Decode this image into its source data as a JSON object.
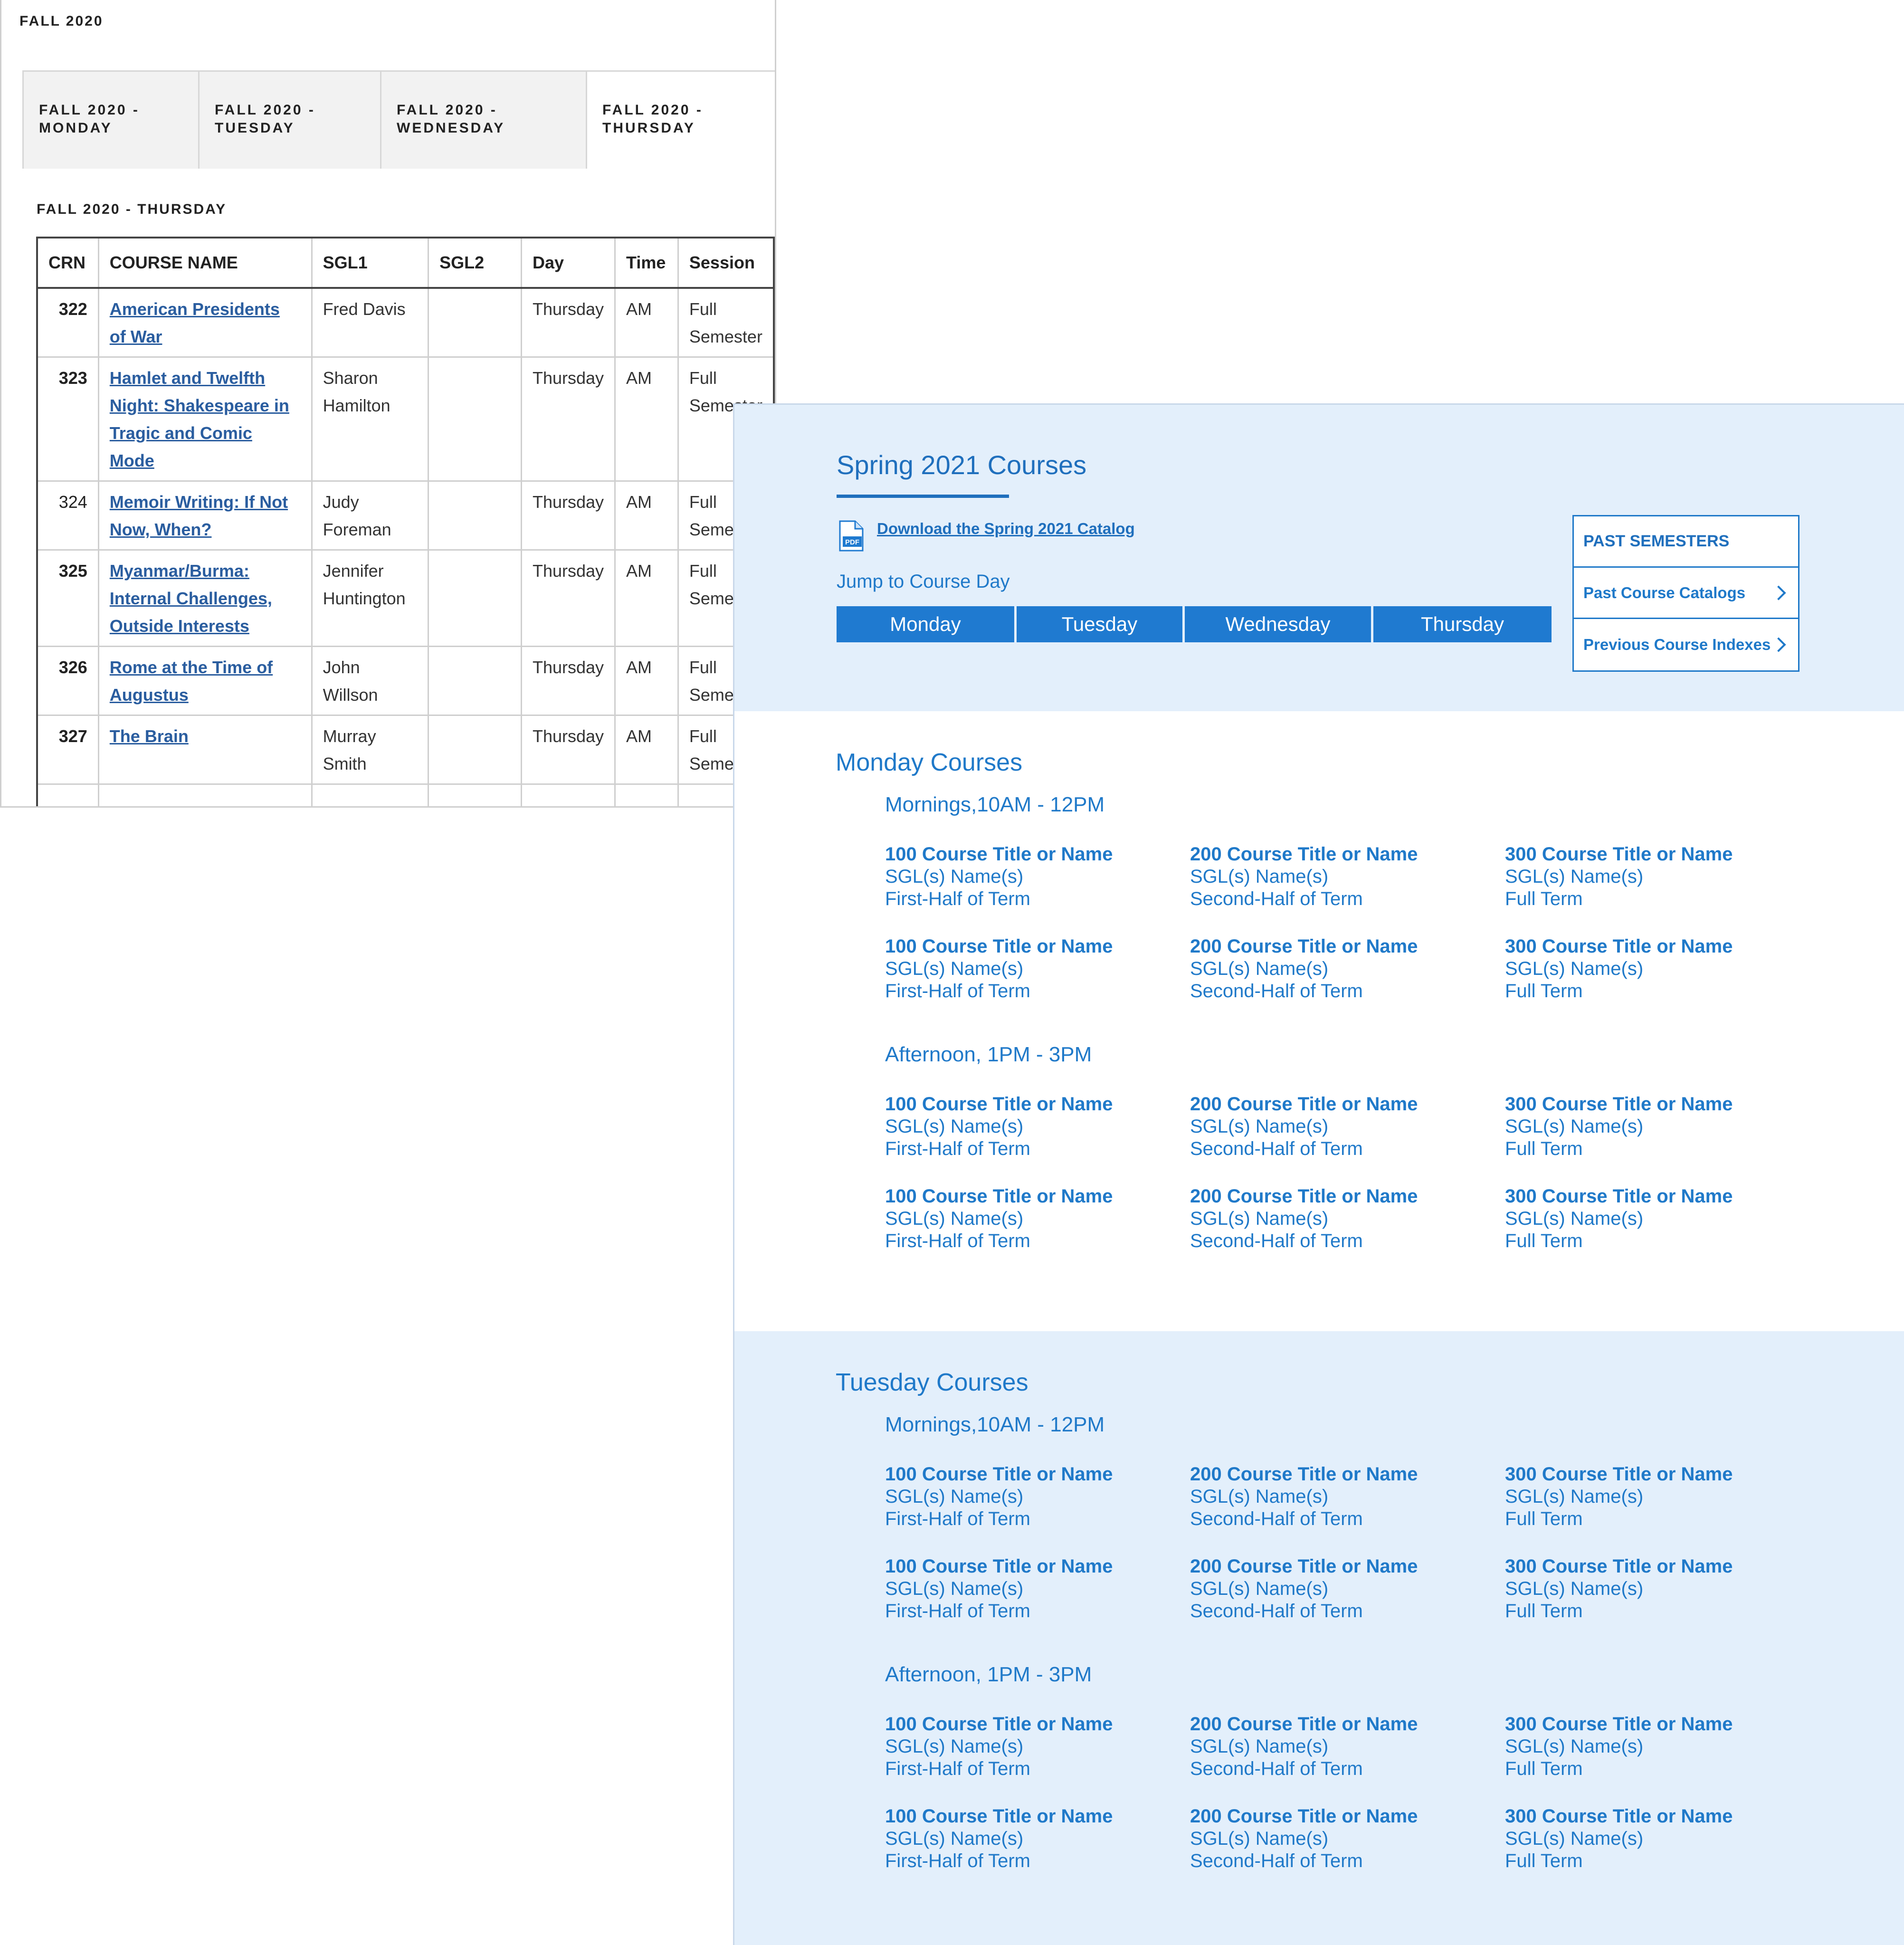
{
  "fall": {
    "title": "FALL 2020",
    "tabs": [
      "FALL 2020 -\nMONDAY",
      "FALL 2020 -\nTUESDAY",
      "FALL 2020 -\nWEDNESDAY",
      "FALL 2020 -\nTHURSDAY"
    ],
    "active_tab": 3,
    "section_title": "FALL 2020 - THURSDAY",
    "table": {
      "headers": [
        "CRN",
        "COURSE NAME",
        "SGL1",
        "SGL2",
        "Day",
        "Time",
        "Session"
      ],
      "rows": [
        {
          "crn": "322",
          "name": "American Presidents of War",
          "sgl1": "Fred Davis",
          "sgl2": "",
          "day": "Thursday",
          "time": "AM",
          "session": "Full Semester"
        },
        {
          "crn": "323",
          "name": "Hamlet and Twelfth Night: Shakespeare in Tragic and Comic Mode",
          "sgl1": "Sharon Hamilton",
          "sgl2": "",
          "day": "Thursday",
          "time": "AM",
          "session": "Full Semester"
        },
        {
          "crn": "324",
          "name": "Memoir Writing: If Not Now, When?",
          "sgl1": "Judy Foreman",
          "sgl2": "",
          "day": "Thursday",
          "time": "AM",
          "session": "Full Semester"
        },
        {
          "crn": "325",
          "name": "Myanmar/Burma: Internal Challenges, Outside Interests",
          "sgl1": "Jennifer Huntington",
          "sgl2": "",
          "day": "Thursday",
          "time": "AM",
          "session": "Full Semester"
        },
        {
          "crn": "326",
          "name": "Rome at the Time of Augustus",
          "sgl1": "John Willson",
          "sgl2": "",
          "day": "Thursday",
          "time": "AM",
          "session": "Full Semester"
        },
        {
          "crn": "327",
          "name": "The Brain",
          "sgl1": "Murray Smith",
          "sgl2": "",
          "day": "Thursday",
          "time": "AM",
          "session": "Full Semester"
        }
      ]
    }
  },
  "spring": {
    "title": "Spring 2021 Courses",
    "download_label": "Download the Spring 2021 Catalog",
    "pdf_icon_label": "PDF",
    "jump_label": "Jump to Course Day",
    "day_buttons": [
      "Monday",
      "Tuesday",
      "Wednesday",
      "Thursday"
    ],
    "past": {
      "header": "PAST SEMESTERS",
      "links": [
        "Past Course Catalogs",
        "Previous Course Indexes"
      ]
    },
    "days": [
      {
        "title": "Monday Courses",
        "periods": [
          {
            "title": "Mornings,10AM - 12PM",
            "rows": [
              [
                {
                  "title": "100 Course Title or Name",
                  "sgl": "SGL(s) Name(s)",
                  "term": "First-Half of Term"
                },
                {
                  "title": "200 Course Title or Name",
                  "sgl": "SGL(s) Name(s)",
                  "term": "Second-Half of Term"
                },
                {
                  "title": "300 Course Title or Name",
                  "sgl": "SGL(s) Name(s)",
                  "term": "Full Term"
                }
              ],
              [
                {
                  "title": "100 Course Title or Name",
                  "sgl": "SGL(s) Name(s)",
                  "term": "First-Half of Term"
                },
                {
                  "title": "200 Course Title or Name",
                  "sgl": "SGL(s) Name(s)",
                  "term": "Second-Half of Term"
                },
                {
                  "title": "300 Course Title or Name",
                  "sgl": "SGL(s) Name(s)",
                  "term": "Full Term"
                }
              ]
            ]
          },
          {
            "title": "Afternoon, 1PM - 3PM",
            "rows": [
              [
                {
                  "title": "100 Course Title or Name",
                  "sgl": "SGL(s) Name(s)",
                  "term": "First-Half of Term"
                },
                {
                  "title": "200 Course Title or Name",
                  "sgl": "SGL(s) Name(s)",
                  "term": "Second-Half of Term"
                },
                {
                  "title": "300 Course Title or Name",
                  "sgl": "SGL(s) Name(s)",
                  "term": "Full Term"
                }
              ],
              [
                {
                  "title": "100 Course Title or Name",
                  "sgl": "SGL(s) Name(s)",
                  "term": "First-Half of Term"
                },
                {
                  "title": "200 Course Title or Name",
                  "sgl": "SGL(s) Name(s)",
                  "term": "Second-Half of Term"
                },
                {
                  "title": "300 Course Title or Name",
                  "sgl": "SGL(s) Name(s)",
                  "term": "Full Term"
                }
              ]
            ]
          }
        ]
      },
      {
        "title": "Tuesday Courses",
        "periods": [
          {
            "title": "Mornings,10AM - 12PM",
            "rows": [
              [
                {
                  "title": "100 Course Title or Name",
                  "sgl": "SGL(s) Name(s)",
                  "term": "First-Half of Term"
                },
                {
                  "title": "200 Course Title or Name",
                  "sgl": "SGL(s) Name(s)",
                  "term": "Second-Half of Term"
                },
                {
                  "title": "300 Course Title or Name",
                  "sgl": "SGL(s) Name(s)",
                  "term": "Full Term"
                }
              ],
              [
                {
                  "title": "100 Course Title or Name",
                  "sgl": "SGL(s) Name(s)",
                  "term": "First-Half of Term"
                },
                {
                  "title": "200 Course Title or Name",
                  "sgl": "SGL(s) Name(s)",
                  "term": "Second-Half of Term"
                },
                {
                  "title": "300 Course Title or Name",
                  "sgl": "SGL(s) Name(s)",
                  "term": "Full Term"
                }
              ]
            ]
          },
          {
            "title": "Afternoon, 1PM - 3PM",
            "rows": [
              [
                {
                  "title": "100 Course Title or Name",
                  "sgl": "SGL(s) Name(s)",
                  "term": "First-Half of Term"
                },
                {
                  "title": "200 Course Title or Name",
                  "sgl": "SGL(s) Name(s)",
                  "term": "Second-Half of Term"
                },
                {
                  "title": "300 Course Title or Name",
                  "sgl": "SGL(s) Name(s)",
                  "term": "Full Term"
                }
              ],
              [
                {
                  "title": "100 Course Title or Name",
                  "sgl": "SGL(s) Name(s)",
                  "term": "First-Half of Term"
                },
                {
                  "title": "200 Course Title or Name",
                  "sgl": "SGL(s) Name(s)",
                  "term": "Second-Half of Term"
                },
                {
                  "title": "300 Course Title or Name",
                  "sgl": "SGL(s) Name(s)",
                  "term": "Full Term"
                }
              ]
            ]
          }
        ]
      }
    ]
  },
  "colors": {
    "accent": "#1f79c9",
    "hero_bg": "#e3effb",
    "button_bg": "#1f7ad0",
    "old_link": "#2a5d9f"
  }
}
